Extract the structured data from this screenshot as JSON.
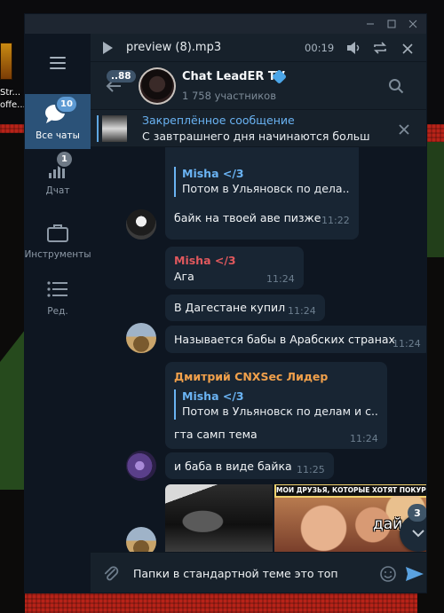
{
  "desktop": {
    "icon_label": "Str...\noffe..."
  },
  "window": {
    "titlebar_buttons": [
      "minimize",
      "maximize",
      "close"
    ]
  },
  "sidebar": {
    "folders": [
      {
        "label": "Все чаты",
        "badge": "10",
        "icon": "chats-icon",
        "active": true
      },
      {
        "label": "Дчат",
        "badge": "1",
        "icon": "chart-icon",
        "active": false
      },
      {
        "label": "Инструменты",
        "badge": "",
        "icon": "briefcase-icon",
        "active": false
      },
      {
        "label": "Ред.",
        "badge": "",
        "icon": "edit-list-icon",
        "active": false
      }
    ]
  },
  "player": {
    "title": "preview (8).mp3",
    "time": "00:19"
  },
  "chat": {
    "unread": "..88",
    "name": "Chat LeadER TV",
    "members": "1 758 участников"
  },
  "pinned": {
    "title": "Закреплённое сообщение",
    "text": "С завтрашнего дня начинаются больш..."
  },
  "messages": [
    {
      "id": "m1",
      "reply_name": "Misha </3",
      "reply_text": "Потом в Ульяновск по дела...",
      "text": "байк на твоей аве пизже",
      "time": "11:22"
    },
    {
      "id": "m2",
      "sender": "Misha </3",
      "sender_color": "#e0585d",
      "text": "Ага",
      "time": "11:24"
    },
    {
      "id": "m3",
      "text": "В Дагестане купил",
      "time": "11:24"
    },
    {
      "id": "m4",
      "text": "Называется бабы в Арабских странах",
      "time": "11:24"
    },
    {
      "id": "m5",
      "sender": "Дмитрий CNXSec Лидер",
      "sender_color": "#f0a04b",
      "reply_name": "Misha </3",
      "reply_text": "Потом в Ульяновск по делам и с...",
      "text": "гта самп тема",
      "time": "11:24"
    },
    {
      "id": "m6",
      "text": "и баба в виде байка",
      "time": "11:25"
    }
  ],
  "media": {
    "meme_caption": "МОИ ДРУЗЬЯ, КОТОРЫЕ ХОТЯТ ПОКУРИТЬ:",
    "meme_word": "дай"
  },
  "scroll_down": {
    "badge": "3"
  },
  "composer": {
    "value": "Папки в стандартной теме это топ"
  },
  "colors": {
    "window_bg": "#17212b",
    "chat_bg": "#0e1621",
    "bubble": "#182533",
    "accent": "#6ab3f3",
    "active_folder": "#2b5278"
  }
}
